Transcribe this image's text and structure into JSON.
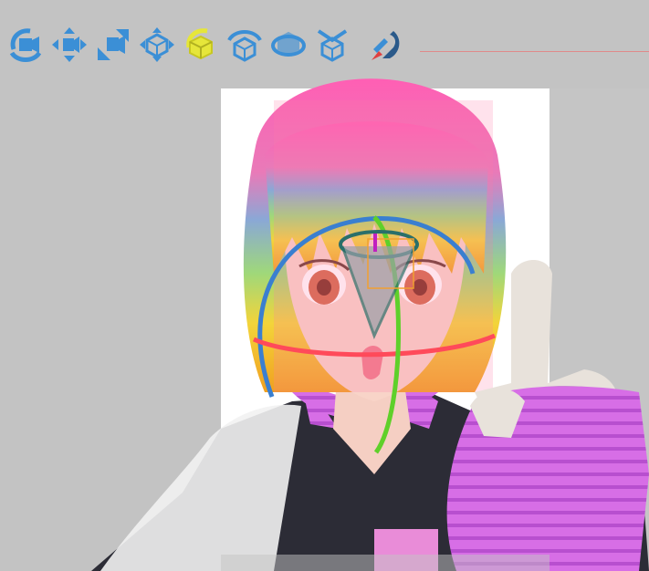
{
  "toolbar": {
    "tools": [
      {
        "icon": "rotate-camera-icon",
        "active": false
      },
      {
        "icon": "move-xy-icon",
        "active": false
      },
      {
        "icon": "move-z-icon",
        "active": false
      },
      {
        "icon": "move-bone-icon",
        "active": false
      },
      {
        "icon": "rotate-bone-icon",
        "active": true
      },
      {
        "icon": "rotate-x-icon",
        "active": false
      },
      {
        "icon": "rotate-y-icon",
        "active": false
      },
      {
        "icon": "rotate-z-icon",
        "active": false
      },
      {
        "icon": "ik-magnet-icon",
        "active": false
      }
    ]
  },
  "colors": {
    "background": "#c3c3c3",
    "icon_blue": "#3b8fd6",
    "icon_active": "#e6e63a",
    "gizmo_x": "#ff4a5a",
    "gizmo_y": "#5fd02a",
    "gizmo_z": "#3a7fd0",
    "bone_cone": "#2a6f6a"
  }
}
